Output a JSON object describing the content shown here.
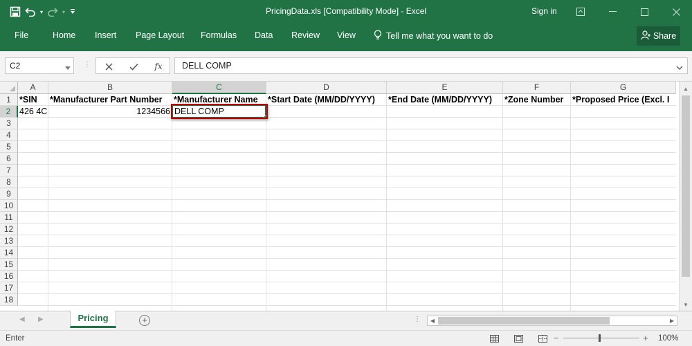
{
  "window": {
    "title": "PricingData.xls  [Compatibility Mode] - Excel",
    "signin": "Sign in"
  },
  "ribbon": {
    "tabs": [
      "File",
      "Home",
      "Insert",
      "Page Layout",
      "Formulas",
      "Data",
      "Review",
      "View"
    ],
    "tellme": "Tell me what you want to do",
    "share": "Share"
  },
  "formula_bar": {
    "name_box": "C2",
    "fx_label": "fx",
    "content": "DELL COMP"
  },
  "grid": {
    "columns": [
      "A",
      "B",
      "C",
      "D",
      "E",
      "F",
      "G"
    ],
    "selected_column": "C",
    "rows": [
      "1",
      "2",
      "3",
      "4",
      "5",
      "6",
      "7",
      "8",
      "9",
      "10",
      "11",
      "12",
      "13",
      "14",
      "15",
      "16",
      "17",
      "18"
    ],
    "selected_row": "2",
    "header_row": {
      "A": "*SIN",
      "B": "*Manufacturer Part Number",
      "C": "*Manufacturer Name",
      "D": "*Start Date (MM/DD/YYYY)",
      "E": "*End Date (MM/DD/YYYY)",
      "F": "*Zone Number",
      "G": "*Proposed Price (Excl. I"
    },
    "data_row": {
      "A": "426 4C",
      "B": "1234566",
      "C": "DELL COMP"
    }
  },
  "sheets": {
    "active": "Pricing"
  },
  "status": {
    "mode": "Enter",
    "zoom": "100%"
  },
  "colors": {
    "accent": "#217346",
    "highlight": "#c00000"
  }
}
